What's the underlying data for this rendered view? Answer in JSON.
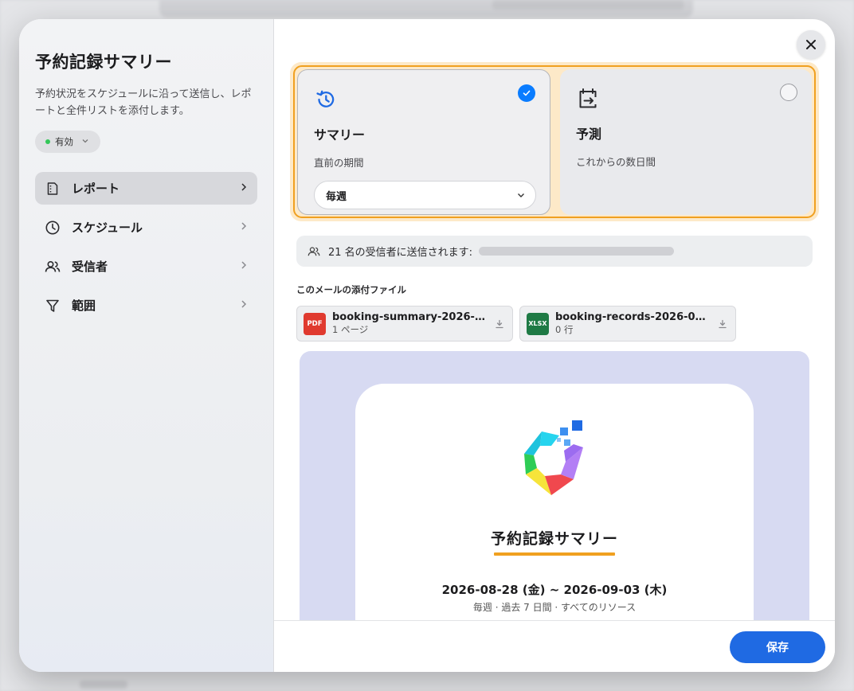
{
  "sidebar": {
    "title": "予約記録サマリー",
    "description": "予約状況をスケジュールに沿って送信し、レポートと全件リストを添付します。",
    "status": "有効",
    "items": [
      {
        "label": "レポート",
        "icon": "report-icon"
      },
      {
        "label": "スケジュール",
        "icon": "clock-icon"
      },
      {
        "label": "受信者",
        "icon": "people-icon"
      },
      {
        "label": "範囲",
        "icon": "filter-icon"
      }
    ]
  },
  "modes": [
    {
      "title": "サマリー",
      "subtitle": "直前の期間",
      "selected": true,
      "icon": "history-icon"
    },
    {
      "title": "予測",
      "subtitle": "これからの数日間",
      "selected": false,
      "icon": "calendar-forward-icon"
    }
  ],
  "frequency": "毎週",
  "recipients": {
    "text": "21 名の受信者に送信されます:"
  },
  "attachments": {
    "heading": "このメールの添付ファイル",
    "files": [
      {
        "type": "PDF",
        "name": "booking-summary-2026-08…",
        "meta": "1 ページ"
      },
      {
        "type": "XLSX",
        "name": "booking-records-2026-08-…",
        "meta": "0 行"
      }
    ]
  },
  "preview": {
    "title": "予約記録サマリー",
    "dates": "2026-08-28 (金) ~ 2026-09-03 (木)",
    "meta": "毎週 · 過去 7 日間 · すべてのリソース"
  },
  "footer": {
    "save": "保存"
  },
  "colors": {
    "accent": "#1f6ae3",
    "highlight": "#f0a020",
    "check": "#0a7cff",
    "status_dot": "#34c759"
  }
}
